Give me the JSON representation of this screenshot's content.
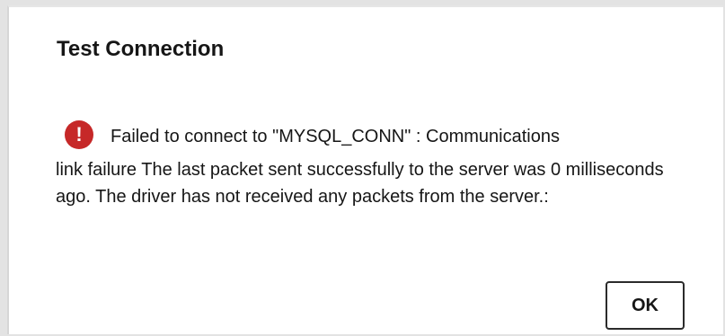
{
  "dialog": {
    "title": "Test Connection",
    "error_icon_glyph": "!",
    "error_icon_name": "error-icon",
    "error_color": "#c62828",
    "message_first_line": "Failed to connect to \"MYSQL_CONN\" : Communications",
    "message_rest": "link failure The last packet sent successfully to the server was 0 milliseconds ago. The driver has not received any packets from the server.:",
    "ok_label": "OK"
  }
}
